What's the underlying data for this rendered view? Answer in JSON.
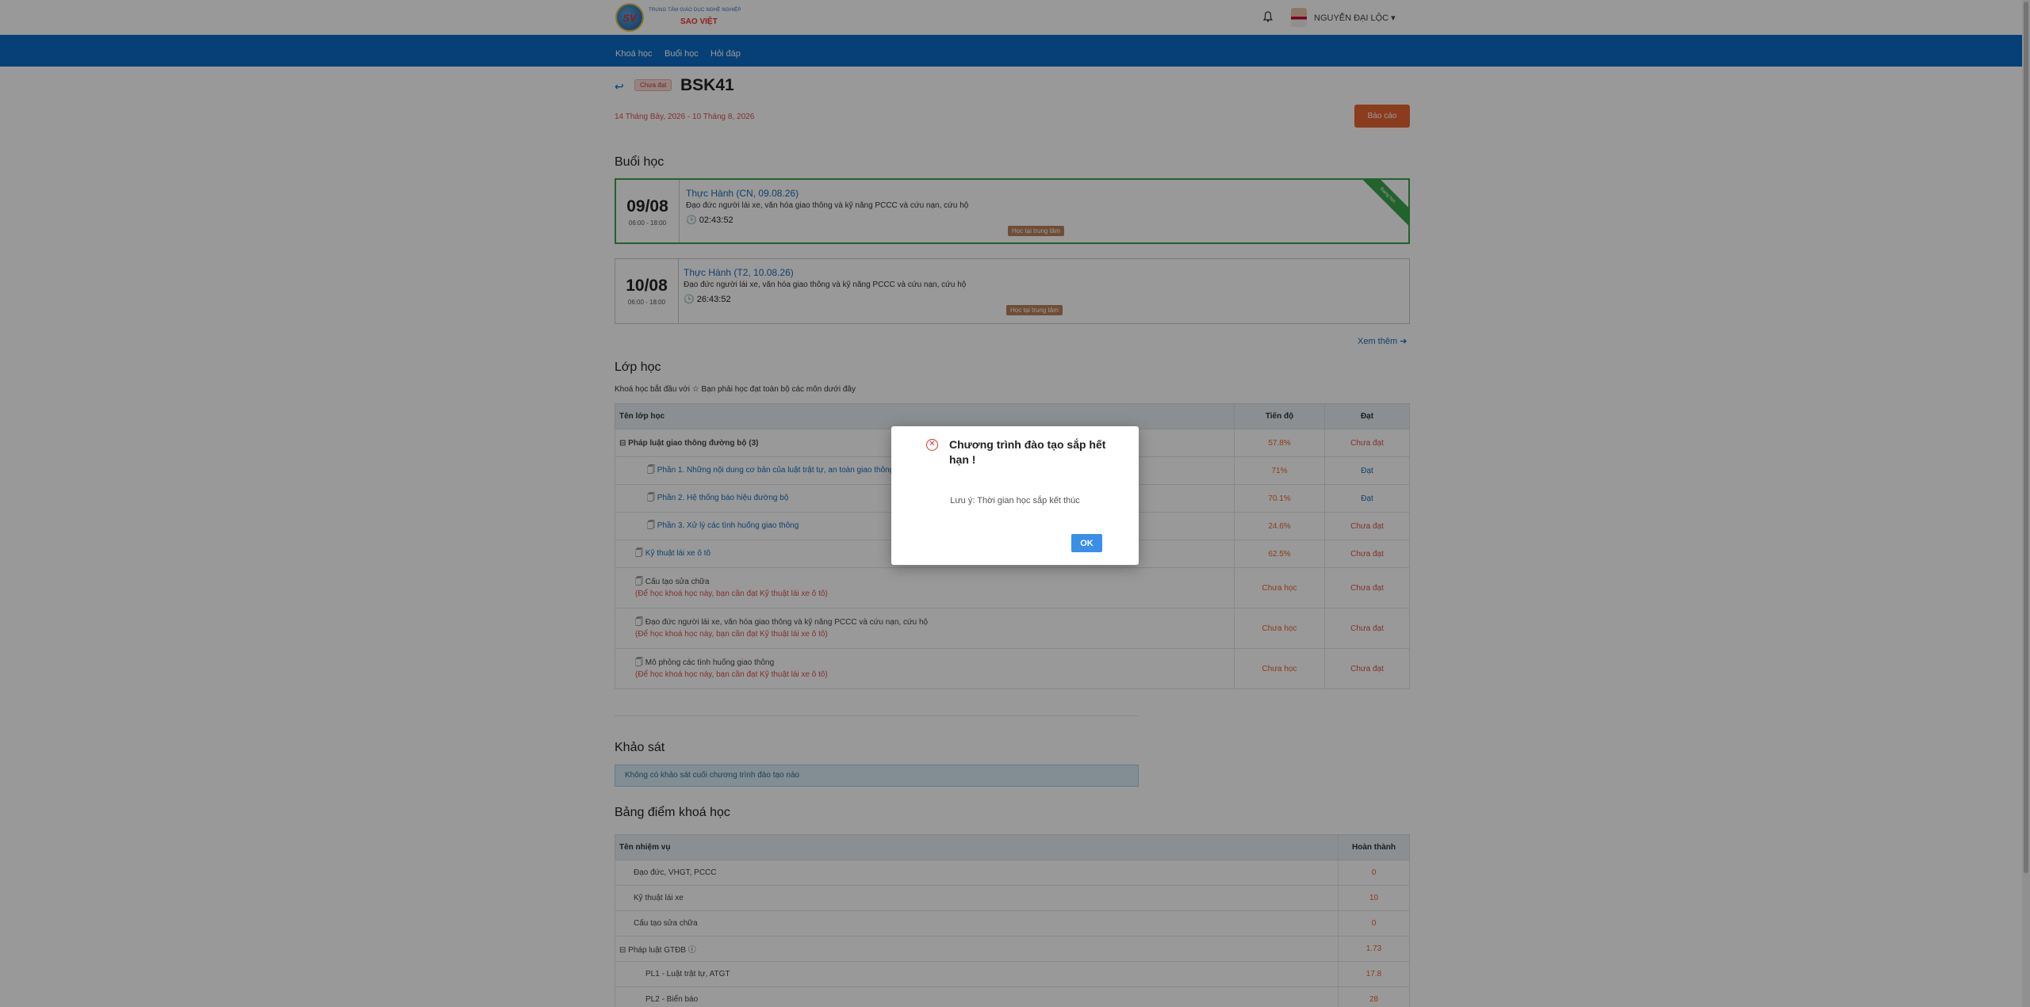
{
  "header": {
    "brand_top": "TRUNG TÂM GIÁO DỤC NGHỀ NGHIỆP",
    "brand_name": "SAO VIỆT",
    "logo_text": "SV",
    "username": "NGUYỄN ĐẠI LỘC ▾"
  },
  "nav": [
    "Khoá học",
    "Buổi học",
    "Hỏi đáp"
  ],
  "course": {
    "status_badge": "Chưa đạt",
    "code": "BSK41",
    "date_range": "14 Tháng Bảy, 2026 - 10 Tháng 8, 2026",
    "report_label": "Báo cáo"
  },
  "sessions_title": "Buổi học",
  "sessions": [
    {
      "day": "09/08",
      "time": "06:00 - 18:00",
      "title": "Thực Hành (CN, 09.08.26)",
      "desc": "Đạo đức người lái xe, văn hóa giao thông và kỹ năng PCCC và cứu nạn, cứu hộ",
      "countdown": "02:43:52",
      "tag": "Học tại trung tâm",
      "ribbon": "Đang học"
    },
    {
      "day": "10/08",
      "time": "06:00 - 18:00",
      "title": "Thực Hành (T2, 10.08.26)",
      "desc": "Đạo đức người lái xe, văn hóa giao thông và kỹ năng PCCC và cứu nạn, cứu hộ",
      "countdown": "26:43:52",
      "tag": "Học tại trung tâm"
    }
  ],
  "see_more": "Xem thêm",
  "classes_title": "Lớp học",
  "classes_note": "Khoá học bắt đầu với ☆ Bạn phải học đạt toàn bộ các môn dưới đây",
  "classes_table": {
    "headers": [
      "Tên lớp học",
      "Tiến độ",
      "Đạt"
    ],
    "rows": [
      {
        "name": "Pháp luật giao thông đường bộ (3)",
        "progress": "57.8%",
        "status": "Chưa đạt"
      },
      {
        "name": "Phần 1. Những nội dung cơ bản của luật trật tự, an toàn giao thông đường bộ",
        "progress": "71%",
        "status": "Đạt"
      },
      {
        "name": "Phần 2. Hệ thống báo hiệu đường bộ",
        "progress": "70.1%",
        "status": "Đạt"
      },
      {
        "name": "Phần 3. Xử lý các tình huống giao thông",
        "progress": "24.6%",
        "status": "Chưa đạt"
      },
      {
        "name": "Kỹ thuật lái xe ô tô",
        "progress": "62.5%",
        "status": "Chưa đạt"
      },
      {
        "name": "Cấu tạo sửa chữa",
        "note": "(Để học khoá học này, bạn cần đạt Kỹ thuật lái xe ô tô)",
        "progress": "Chưa học",
        "status": "Chưa đạt"
      },
      {
        "name": "Đạo đức người lái xe, văn hóa giao thông và kỹ năng PCCC và cứu nạn, cứu hộ",
        "note": "(Để học khoá học này, bạn cần đạt Kỹ thuật lái xe ô tô)",
        "progress": "Chưa học",
        "status": "Chưa đạt"
      },
      {
        "name": "Mô phỏng các tình huống giao thông",
        "note": "(Để học khoá học này, bạn cần đạt Kỹ thuật lái xe ô tô)",
        "progress": "Chưa học",
        "status": "Chưa đạt"
      }
    ]
  },
  "survey_title": "Khảo sát",
  "survey_info": "Không có khảo sát cuối chương trình đào tạo nào",
  "scores_title": "Bảng điểm khoá học",
  "scores_table": {
    "headers": [
      "Tên nhiệm vụ",
      "Hoàn thành"
    ],
    "rows": [
      {
        "name": "Đạo đức, VHGT, PCCC",
        "value": "0"
      },
      {
        "name": "Kỹ thuật lái xe",
        "value": "10"
      },
      {
        "name": "Cấu tạo sửa chữa",
        "value": "0"
      },
      {
        "name": "Pháp luật GTĐB ⓘ",
        "value": "1.73"
      },
      {
        "name": "PL1 - Luật trật tự, ATGT",
        "value": "17.8"
      },
      {
        "name": "PL2 - Biển báo",
        "value": "28"
      }
    ]
  },
  "modal": {
    "title": "Chương trình đào tạo sắp hết hạn !",
    "message": "Lưu ý: Thời gian học sắp kết thúc",
    "ok_label": "OK"
  }
}
